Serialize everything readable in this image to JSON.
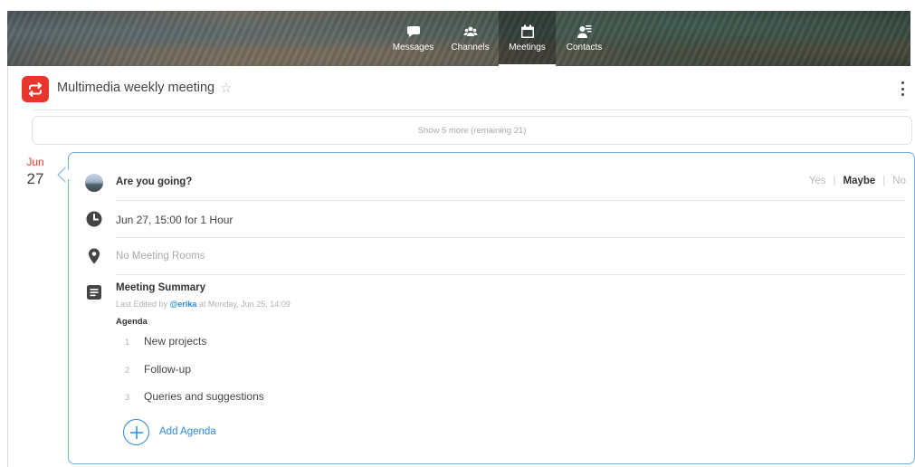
{
  "nav": {
    "items": [
      {
        "label": "Messages",
        "icon": "messages-icon"
      },
      {
        "label": "Channels",
        "icon": "channels-icon"
      },
      {
        "label": "Meetings",
        "icon": "meetings-icon",
        "active": true
      },
      {
        "label": "Contacts",
        "icon": "contacts-icon"
      }
    ]
  },
  "header": {
    "title": "Multimedia weekly meeting",
    "star": "☆",
    "app_icon": "repeat-icon",
    "accent_color": "#e8362d"
  },
  "history": {
    "show_more": "Show 5 more (remaining 21)"
  },
  "date": {
    "month": "Jun",
    "day": "27"
  },
  "meeting": {
    "question": "Are you going?",
    "rsvp": {
      "yes": "Yes",
      "maybe": "Maybe",
      "no": "No",
      "separator": "|",
      "selected": "Maybe"
    },
    "time": "Jun 27, 15:00 for 1 Hour",
    "room": "No Meeting Rooms",
    "summary": {
      "title": "Meeting Summary",
      "edited_prefix": "Last Edited by",
      "edited_user": "@erika",
      "edited_suffix": "at Monday, Jun 25, 14:09",
      "agenda_label": "Agenda",
      "items": [
        {
          "num": "1",
          "text": "New projects"
        },
        {
          "num": "2",
          "text": "Follow-up"
        },
        {
          "num": "3",
          "text": "Queries and suggestions"
        }
      ]
    },
    "add_agenda": "Add Agenda",
    "link_color": "#2e8bd8",
    "border_color": "#6fb0e3"
  }
}
